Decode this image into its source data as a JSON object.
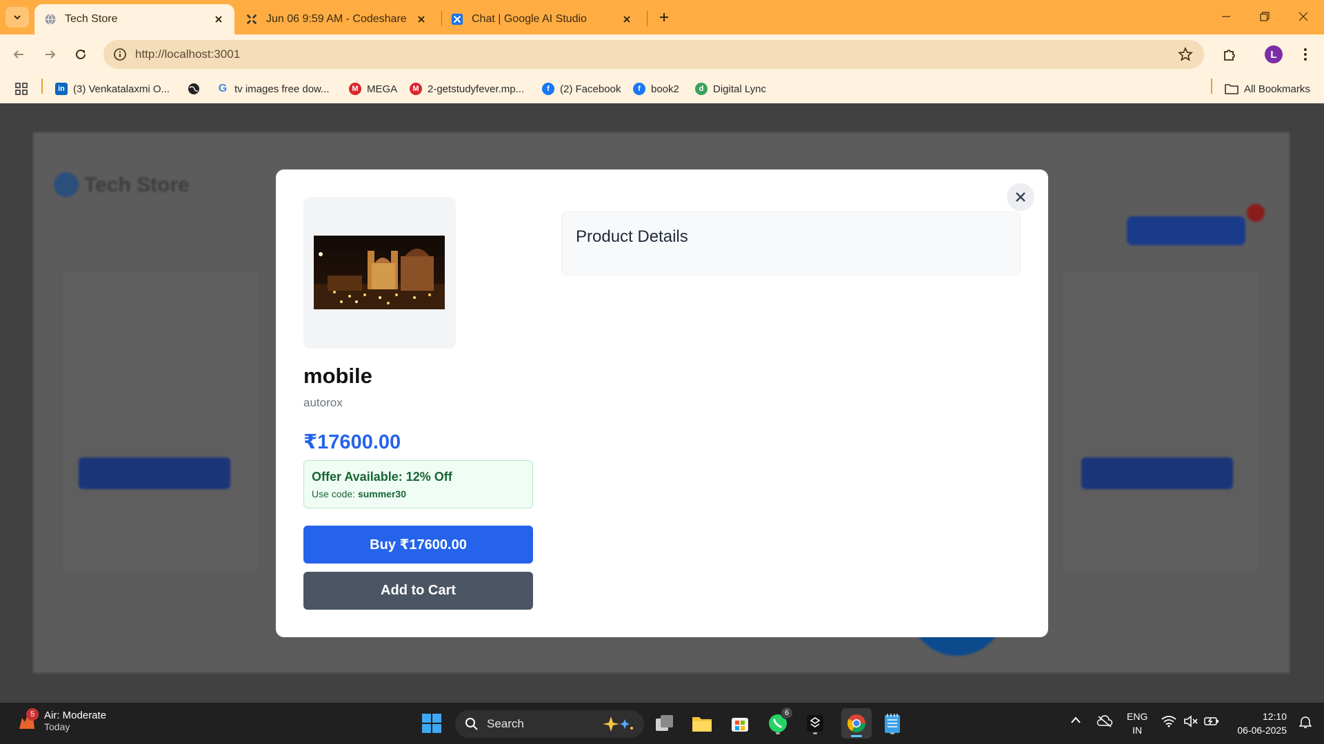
{
  "browser": {
    "tabs": [
      {
        "title": "Tech Store",
        "active": true,
        "icon": "globe-icon"
      },
      {
        "title": "Jun 06 9:59 AM - Codeshare",
        "active": false,
        "icon": "codeshare-icon"
      },
      {
        "title": "Chat | Google AI Studio",
        "active": false,
        "icon": "ai-studio-icon"
      }
    ],
    "url": "http://localhost:3001",
    "profile_initial": "L",
    "bookmarks": [
      {
        "label": "(3) Venkatalaxmi O...",
        "icon": "linkedin-icon",
        "color": "#0a66c2"
      },
      {
        "label": "",
        "icon": "globe-dark-icon",
        "color": "#222222"
      },
      {
        "label": "tv images free dow...",
        "icon": "google-icon",
        "color": "#4285f4"
      },
      {
        "label": "MEGA",
        "icon": "mega-icon",
        "color": "#d9272e"
      },
      {
        "label": "2-getstudyfever.mp...",
        "icon": "mega-icon",
        "color": "#d9272e"
      },
      {
        "label": "(2) Facebook",
        "icon": "facebook-icon",
        "color": "#1877f2"
      },
      {
        "label": "book2",
        "icon": "facebook-icon",
        "color": "#1877f2"
      },
      {
        "label": "Digital Lync",
        "icon": "digital-lync-icon",
        "color": "#3aa35a"
      }
    ],
    "all_bookmarks": "All Bookmarks"
  },
  "modal": {
    "product_name": "mobile",
    "brand": "autorox",
    "price": "₹17600.00",
    "offer_title": "Offer Available: 12% Off",
    "offer_code_prefix": "Use code:",
    "offer_code": "summer30",
    "buy_label": "Buy ₹17600.00",
    "cart_label": "Add to Cart",
    "details_title": "Product Details"
  },
  "background_page": {
    "app_title": "Tech Store"
  },
  "taskbar": {
    "weather_title": "Air: Moderate",
    "weather_sub": "Today",
    "weather_badge": "5",
    "search_label": "Search",
    "whatsapp_badge": "6",
    "lang_top": "ENG",
    "lang_bottom": "IN",
    "time": "12:10",
    "date": "06-06-2025"
  }
}
